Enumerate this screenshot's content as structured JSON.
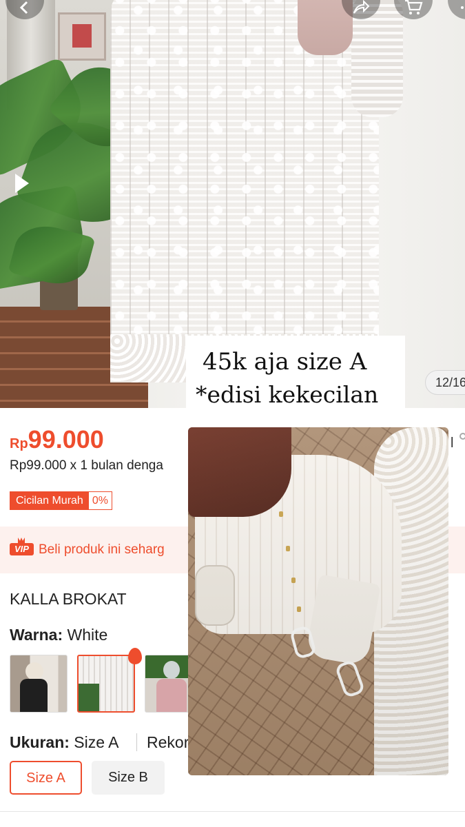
{
  "header": {
    "back_icon": "back-arrow-icon",
    "share_icon": "share-icon",
    "cart_icon": "cart-icon",
    "more_icon": "more-icon"
  },
  "gallery": {
    "counter": "12/16",
    "video_icon": "play-icon"
  },
  "caption": {
    "line1": "45k  aja size A",
    "line2": "*edisi kekecilan"
  },
  "product": {
    "currency": "Rp",
    "price": "99.000",
    "installment": "Rp99.000 x 1 bulan denga",
    "cicilan_label": "Cicilan Murah",
    "cicilan_rate": "0%",
    "vip_badge": "VIP",
    "vip_text": "Beli produk ini seharg",
    "right_edge_text": "l",
    "name": "KALLA BROKAT"
  },
  "variants": {
    "color_label": "Warna:",
    "color_value": "White",
    "thumbnails": [
      "variant-black",
      "variant-white",
      "variant-pink"
    ],
    "selected_thumbnail": "variant-white"
  },
  "sizes": {
    "label": "Ukuran:",
    "selected_value": "Size A",
    "recommend_text": "Rekor",
    "options": [
      "Size A",
      "Size B"
    ],
    "selected": "Size A"
  },
  "colors": {
    "accent": "#ee4d2d",
    "vip_bg": "#fdf1ee"
  }
}
